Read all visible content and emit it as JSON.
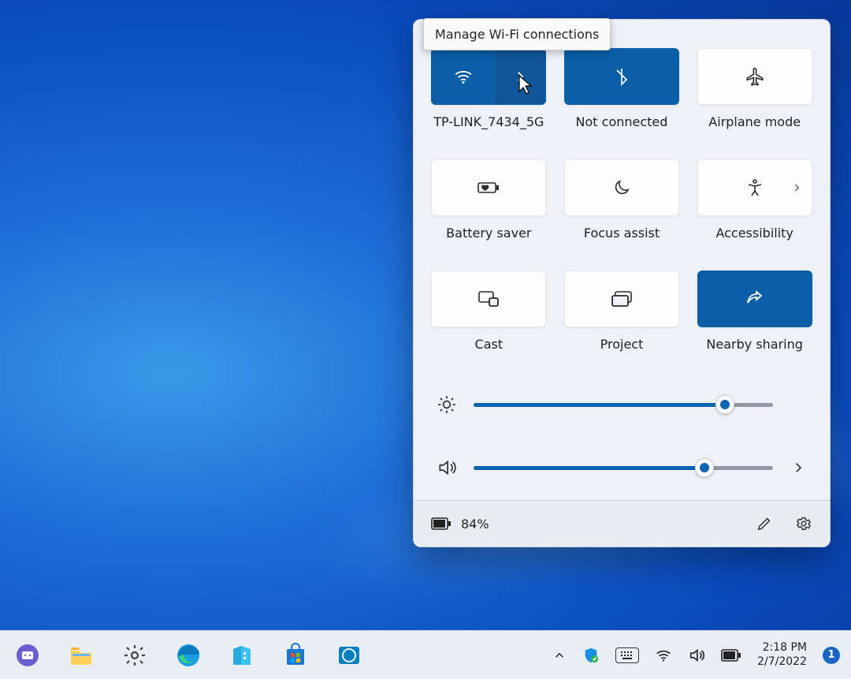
{
  "tooltip": {
    "text": "Manage Wi-Fi connections"
  },
  "tiles": {
    "wifi": {
      "label": "TP-LINK_7434_5G",
      "active": true
    },
    "bluetooth": {
      "label": "Not connected",
      "active": true
    },
    "airplane": {
      "label": "Airplane mode",
      "active": false
    },
    "battery_saver": {
      "label": "Battery saver",
      "active": false
    },
    "focus_assist": {
      "label": "Focus assist",
      "active": false
    },
    "accessibility": {
      "label": "Accessibility",
      "active": false
    },
    "cast": {
      "label": "Cast",
      "active": false
    },
    "project": {
      "label": "Project",
      "active": false
    },
    "nearby": {
      "label": "Nearby sharing",
      "active": true
    }
  },
  "sliders": {
    "brightness": {
      "value": 84
    },
    "volume": {
      "value": 77
    }
  },
  "footer": {
    "battery_text": "84%"
  },
  "taskbar": {
    "time": "2:18 PM",
    "date": "2/7/2022",
    "notification_count": "1"
  }
}
